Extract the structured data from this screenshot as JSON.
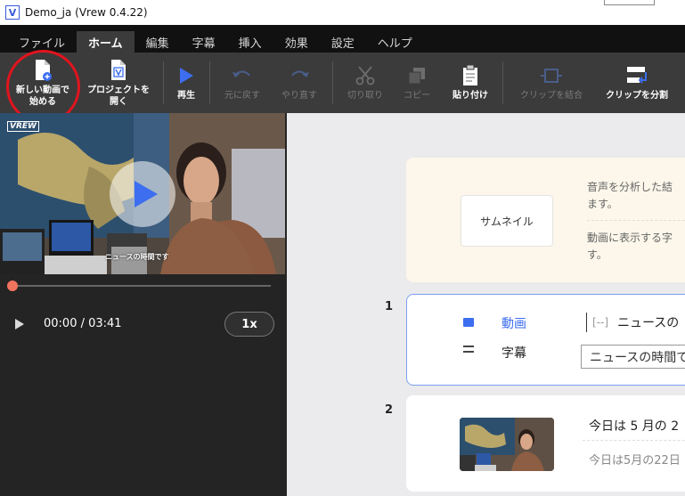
{
  "window": {
    "icon_letter": "V",
    "title": "Demo_ja (Vrew 0.4.22)"
  },
  "menu": {
    "tabs": [
      {
        "label": "ファイル",
        "active": false
      },
      {
        "label": "ホーム",
        "active": true
      },
      {
        "label": "編集",
        "active": false
      },
      {
        "label": "字幕",
        "active": false
      },
      {
        "label": "挿入",
        "active": false
      },
      {
        "label": "効果",
        "active": false
      },
      {
        "label": "設定",
        "active": false
      },
      {
        "label": "ヘルプ",
        "active": false
      }
    ]
  },
  "toolbar": {
    "new_video": "新しい動画で\n始める",
    "open_project": "プロジェクトを\n開く",
    "play": "再生",
    "undo": "元に戻す",
    "redo": "やり直す",
    "cut": "切り取り",
    "copy": "コピー",
    "paste": "貼り付け",
    "merge_clips": "クリップを結合",
    "split_clip": "クリップを分割"
  },
  "player": {
    "watermark": "VREW",
    "caption": "ニュースの時間です",
    "time": "00:00 / 03:41",
    "speed": "1x",
    "progress": 0
  },
  "thumbnail_card": {
    "button": "サムネイル",
    "text_line1": "音声を分析した結",
    "text_line2": "ます。",
    "text_line3": "動画に表示する字",
    "text_line4": "す。"
  },
  "clips": [
    {
      "number": "1",
      "video_label": "動画",
      "subtitle_label": "字幕",
      "tag": "[--]",
      "word": "ニュースの",
      "subtitle_value": "ニュースの時間で"
    },
    {
      "number": "2",
      "text_line1": "今日は 5 月の 2",
      "text_line2": "今日は5月の22日"
    }
  ],
  "colors": {
    "accent_blue": "#3d6ef0",
    "highlight_red": "#e0141e",
    "seek_knob": "#f0735e",
    "toolbar_bg": "#3b3b3b",
    "menubar_bg": "#111111"
  }
}
